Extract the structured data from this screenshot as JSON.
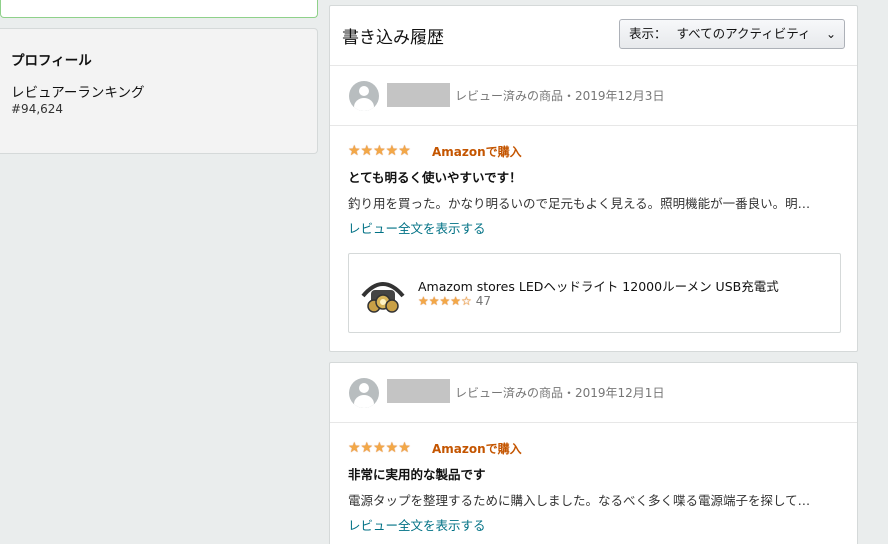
{
  "profile": {
    "title": "プロフィール",
    "rank_label": "レビュアーランキング",
    "rank_value": "#94,624"
  },
  "history": {
    "title": "書き込み履歴",
    "filter": {
      "label": "表示：",
      "value": "すべてのアクティビティ"
    }
  },
  "reviews": [
    {
      "meta": "レビュー済みの商品・2019年12月3日",
      "stars": "★★★★★",
      "verified": "Amazonで購入",
      "title": "とても明るく使いやすいです！",
      "body": "釣り用を買った。かなり明るいので足元もよく見える。照明機能が一番良い。明…",
      "link": "レビュー全文を表示する",
      "product": {
        "name": "Amazom stores LEDヘッドライト 12000ルーメン USB充電式",
        "stars": "★★★★☆",
        "count": "47"
      }
    },
    {
      "meta": "レビュー済みの商品・2019年12月1日",
      "stars": "★★★★★",
      "verified": "Amazonで購入",
      "title": "非常に実用的な製品です",
      "body": "電源タップを整理するために購入しました。なるべく多く喋る電源端子を探して…",
      "link": "レビュー全文を表示する"
    }
  ],
  "icons": {
    "avatar": "user-avatar-icon",
    "dropdown": "chevron-down-icon",
    "star": "star-icon"
  },
  "colors": {
    "link": "#007185",
    "verified": "#c45500",
    "star": "#f3a847"
  }
}
